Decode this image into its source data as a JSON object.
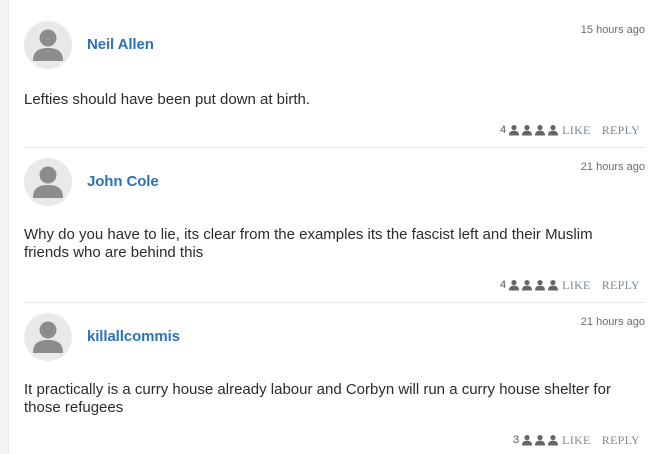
{
  "comments": [
    {
      "author": "Neil Allen",
      "time": "15 hours ago",
      "text": "Lefties should have been put down at birth.",
      "like_count": "4",
      "like_label": "LIKE",
      "reply_label": "REPLY"
    },
    {
      "author": "John Cole",
      "time": "21 hours ago",
      "text": "Why do you have to lie, its clear from the examples its the fascist left and their Muslim friends who are behind this",
      "like_count": "4",
      "like_label": "LIKE",
      "reply_label": "REPLY"
    },
    {
      "author": "killallcommis",
      "time": "21 hours ago",
      "text": "It practically is a curry house already labour and Corbyn will run a curry house shelter for those refugees",
      "like_count": "3",
      "like_label": "LIKE",
      "reply_label": "REPLY"
    }
  ],
  "icons": {
    "avatar": "default-user-avatar-icon",
    "liker": "user-silhouette-icon"
  },
  "colors": {
    "author": "#2a73b8",
    "action": "#7e8894",
    "avatar": "#8c8c8c"
  }
}
